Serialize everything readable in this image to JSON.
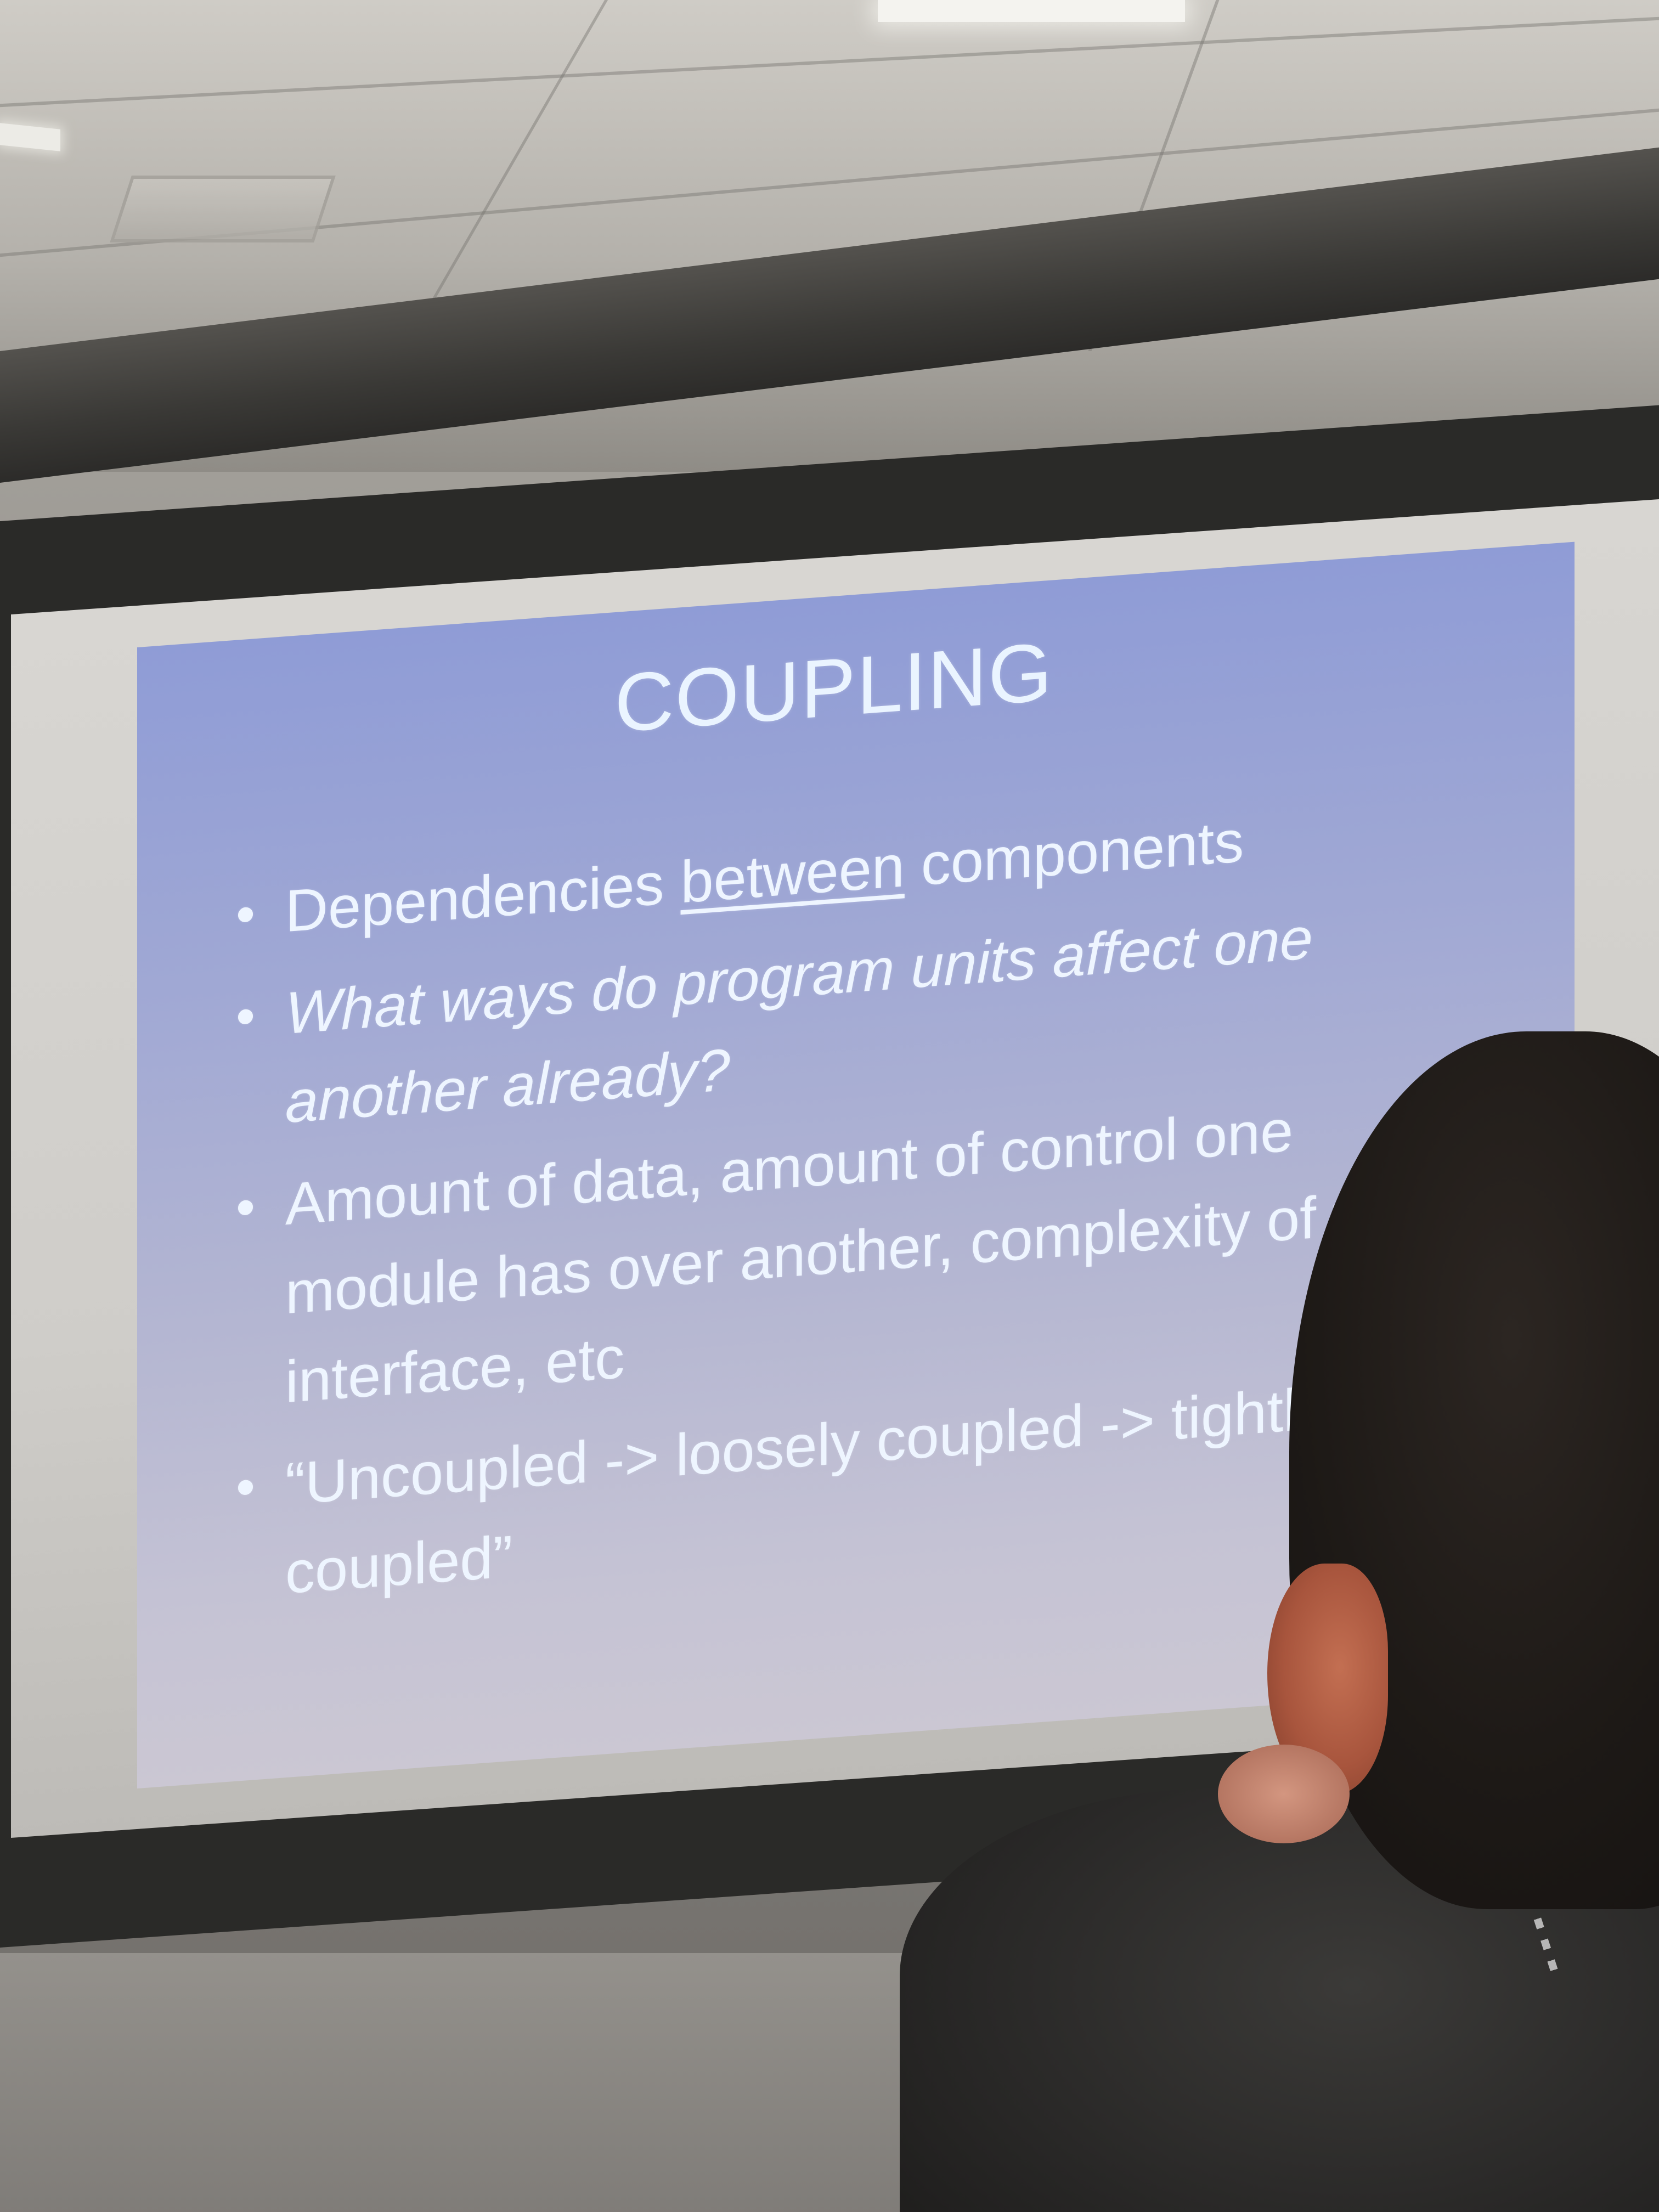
{
  "slide": {
    "title": "COUPLING",
    "bullet_marker": "•",
    "bullets": [
      {
        "before": "Dependencies ",
        "underlined": "between",
        "after": " components",
        "italic": false
      },
      {
        "text": "What ways do program units affect one another already?",
        "italic": true
      },
      {
        "text": "Amount of data, amount of control one module has over another, complexity of th",
        "continuation": "interface, etc",
        "italic": false
      },
      {
        "text": "“Uncoupled -> loosely coupled -> tightly",
        "continuation": "coupled”",
        "italic": false
      }
    ]
  },
  "colors": {
    "slide_top": "#8f9cd6",
    "slide_bottom": "#cbc7d3",
    "slide_text": "#eef5ff",
    "screen_frame": "#2a2a28",
    "hair": "#1d1916",
    "hoodie": "#2a2928"
  }
}
